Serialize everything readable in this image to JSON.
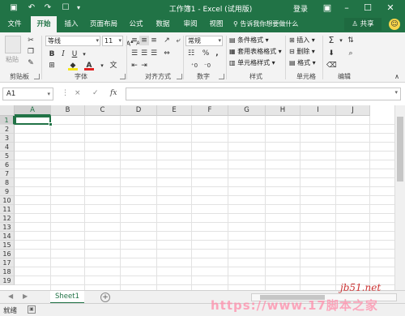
{
  "titlebar": {
    "title": "工作簿1 - Excel (试用版)",
    "login": "登录",
    "save_icon": "save-icon",
    "undo_icon": "undo-icon",
    "redo_icon": "redo-icon",
    "touch_icon": "touch-mode-icon"
  },
  "ribbon_tabs": [
    "文件",
    "开始",
    "插入",
    "页面布局",
    "公式",
    "数据",
    "审阅",
    "视图"
  ],
  "active_tab": "开始",
  "tell_me": "告诉我你想要做什么",
  "share": "共享",
  "ribbon": {
    "clipboard": {
      "paste": "粘贴",
      "label": "剪贴板"
    },
    "font": {
      "name": "等线",
      "size": "11",
      "label": "字体",
      "bold": "B",
      "italic": "I",
      "underline": "U"
    },
    "alignment": {
      "label": "对齐方式"
    },
    "number": {
      "format": "常规",
      "label": "数字",
      "percent": "%"
    },
    "styles": {
      "conditional": "条件格式",
      "table": "套用表格格式",
      "cell": "单元格样式",
      "label": "样式"
    },
    "cells": {
      "insert": "插入",
      "delete": "删除",
      "format": "格式",
      "label": "单元格"
    },
    "editing": {
      "label": "编辑"
    }
  },
  "formula_bar": {
    "name_box": "A1",
    "cancel": "×",
    "enter": "✓",
    "fx": "fx"
  },
  "columns": [
    "A",
    "B",
    "C",
    "D",
    "E",
    "F",
    "G",
    "H",
    "I",
    "J"
  ],
  "rows": [
    "1",
    "2",
    "3",
    "4",
    "5",
    "6",
    "7",
    "8",
    "9",
    "10",
    "11",
    "12",
    "13",
    "14",
    "15",
    "16",
    "17",
    "18",
    "19"
  ],
  "sheet_tabs": [
    "Sheet1"
  ],
  "status": {
    "ready": "就绪"
  },
  "watermarks": {
    "site": "jb51.net",
    "overlay": "https://www.17脚本之家"
  },
  "colors": {
    "brand": "#217346",
    "ribbon_bg": "#f3f3f3"
  }
}
